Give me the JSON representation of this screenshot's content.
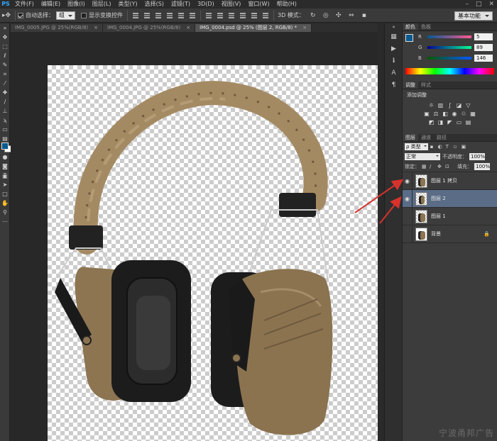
{
  "app": {
    "logo": "PS"
  },
  "menu": [
    "文件(F)",
    "编辑(E)",
    "图像(I)",
    "图层(L)",
    "类型(Y)",
    "选择(S)",
    "滤镜(T)",
    "3D(D)",
    "视图(V)",
    "窗口(W)",
    "帮助(H)"
  ],
  "window_controls": [
    "–",
    "□",
    "✕"
  ],
  "options_bar": {
    "auto_select_label": "自动选择：",
    "auto_select_value": "组",
    "transform_label": "显示变换控件",
    "mode_label": "3D 模式：",
    "workspace": "基本功能"
  },
  "doc_tabs": [
    {
      "label": "IMG_0005.JPG @ 25%(RGB/8)",
      "close": "×"
    },
    {
      "label": "IMG_0004.JPG @ 25%(RGB/8)",
      "close": "×"
    },
    {
      "label": "IMG_0004.psd @ 25% (图层 2, RGB/8) *",
      "close": "×"
    }
  ],
  "color_panel": {
    "tabs": [
      "颜色",
      "色板"
    ],
    "channels": [
      {
        "label": "R",
        "value": "5"
      },
      {
        "label": "G",
        "value": "89"
      },
      {
        "label": "B",
        "value": "146"
      }
    ],
    "foreground": "#05598f"
  },
  "adjust_panel": {
    "tabs": [
      "调整",
      "样式"
    ],
    "title": "添加调整"
  },
  "layers_panel": {
    "tabs": [
      "图层",
      "通道",
      "路径"
    ],
    "filter_kind": "类型",
    "blend_mode": "正常",
    "opacity_label": "不透明度：",
    "opacity": "100%",
    "lock_label": "锁定：",
    "fill_label": "填充：",
    "fill": "100%",
    "layers": [
      {
        "name": "图层 1 拷贝",
        "visible": true,
        "selected": false
      },
      {
        "name": "图层 2",
        "visible": true,
        "selected": true
      },
      {
        "name": "图层 1",
        "visible": false,
        "selected": false
      },
      {
        "name": "背景",
        "visible": false,
        "selected": false,
        "locked": true
      }
    ]
  },
  "watermark": "宁波甬邦广告"
}
